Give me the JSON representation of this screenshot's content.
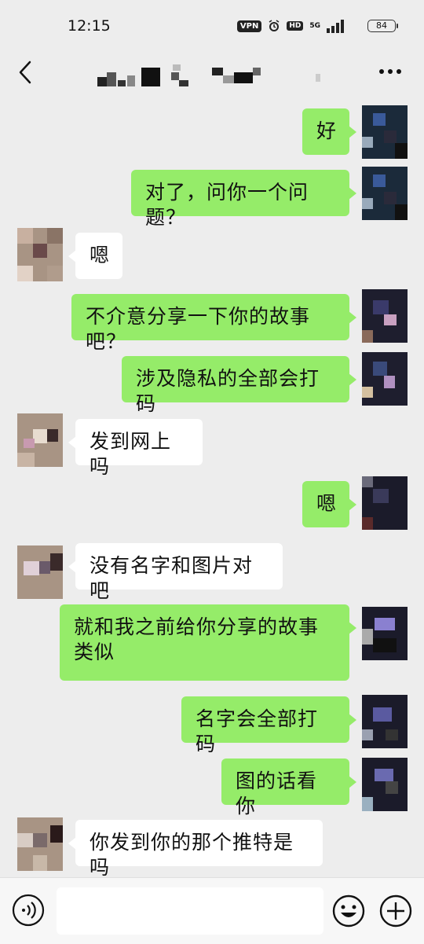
{
  "status_bar": {
    "time": "12:15",
    "vpn": "VPN",
    "hd": "HD",
    "network": "5G",
    "battery": "84"
  },
  "header": {
    "back_icon": "back-chevron-icon",
    "contact_name_pixelated": true,
    "more_icon": "more-dots-icon"
  },
  "colors": {
    "background": "#ededed",
    "outgoing_bubble": "#95ec69",
    "incoming_bubble": "#ffffff"
  },
  "messages": [
    {
      "side": "out",
      "text": "好"
    },
    {
      "side": "out",
      "text": "对了，问你一个问题？"
    },
    {
      "side": "in",
      "text": "嗯"
    },
    {
      "side": "out",
      "text": "不介意分享一下你的故事吧？"
    },
    {
      "side": "out",
      "text": "涉及隐私的全部会打码"
    },
    {
      "side": "in",
      "text": "发到网上吗"
    },
    {
      "side": "out",
      "text": "嗯"
    },
    {
      "side": "in",
      "text": "没有名字和图片对吧"
    },
    {
      "side": "out",
      "text": "就和我之前给你分享的故事类似"
    },
    {
      "side": "out",
      "text": "名字会全部打码"
    },
    {
      "side": "out",
      "text": "图的话看你"
    },
    {
      "side": "in",
      "text": "你发到你的那个推特是吗"
    }
  ],
  "input_bar": {
    "voice_icon": "voice-icon",
    "emoji_icon": "emoji-icon",
    "plus_icon": "plus-icon",
    "placeholder": ""
  }
}
